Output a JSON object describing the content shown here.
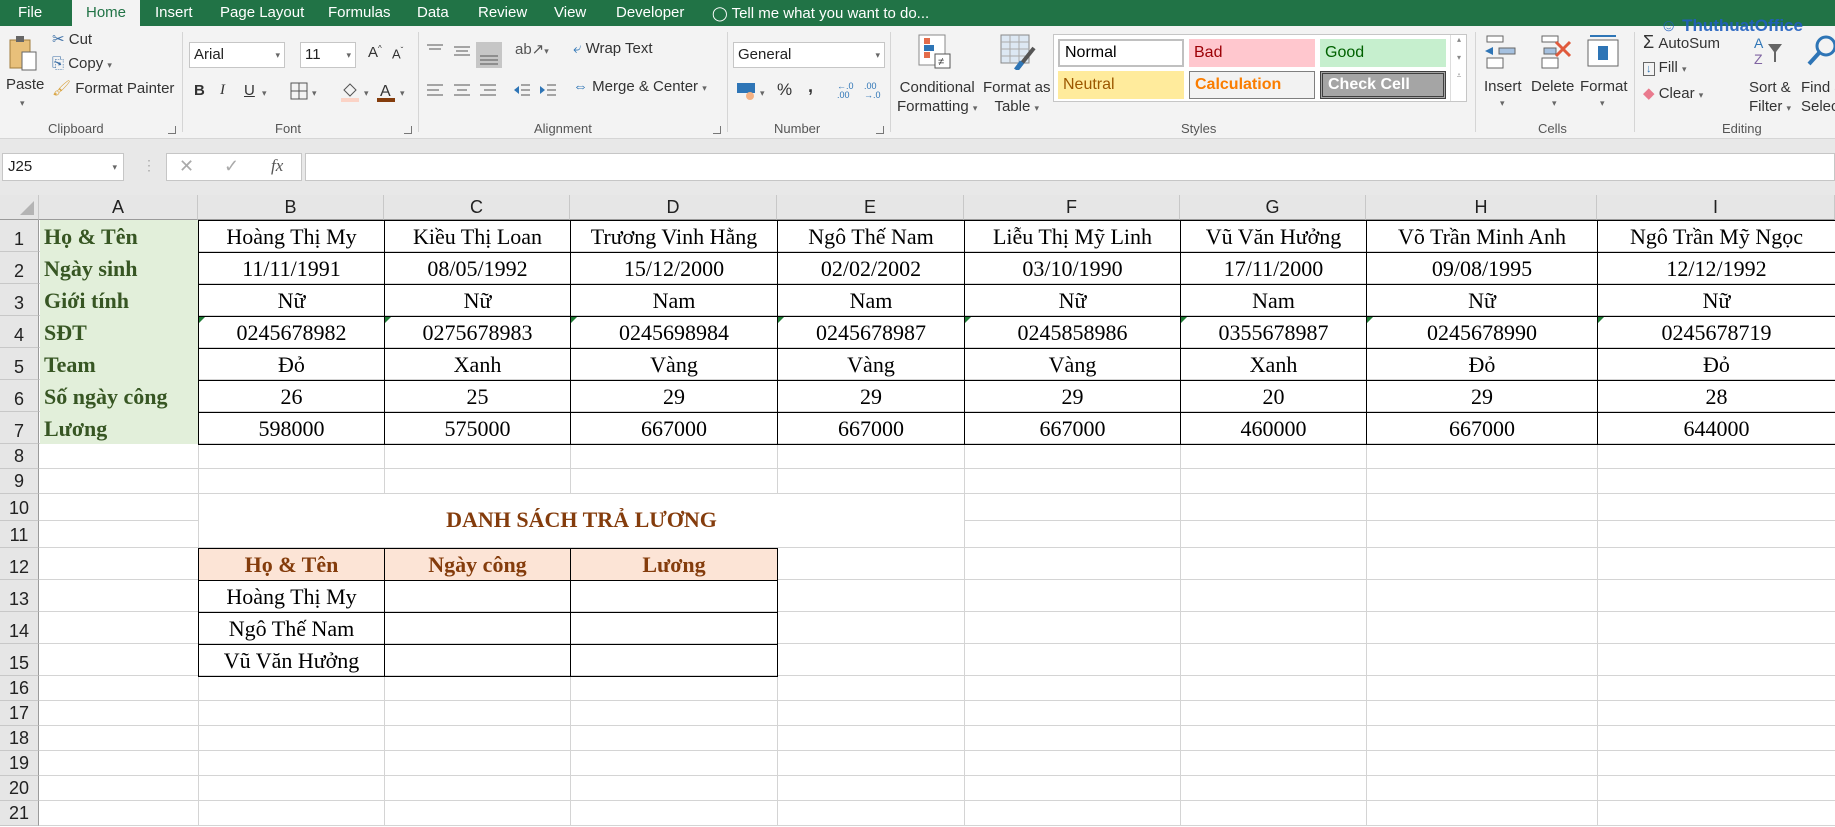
{
  "ribbon_tabs": [
    "File",
    "Home",
    "Insert",
    "Page Layout",
    "Formulas",
    "Data",
    "Review",
    "View",
    "Developer"
  ],
  "active_tab": "Home",
  "tell_me": "Tell me what you want to do...",
  "clipboard": {
    "paste": "Paste",
    "cut": "Cut",
    "copy": "Copy",
    "format_painter": "Format Painter",
    "label": "Clipboard"
  },
  "font": {
    "name": "Arial",
    "size": "11",
    "label": "Font",
    "bold": "B",
    "italic": "I",
    "underline": "U"
  },
  "alignment": {
    "wrap_text": "Wrap Text",
    "merge_center": "Merge & Center",
    "label": "Alignment"
  },
  "number": {
    "format": "General",
    "label": "Number",
    "percent": "%",
    "comma": ","
  },
  "styles": {
    "conditional_formatting": [
      "Conditional",
      "Formatting"
    ],
    "format_as_table": [
      "Format as",
      "Table"
    ],
    "cells": [
      {
        "name": "Normal",
        "fg": "#000000",
        "bg": "#ffffff"
      },
      {
        "name": "Bad",
        "fg": "#9c0006",
        "bg": "#ffc7ce"
      },
      {
        "name": "Good",
        "fg": "#006100",
        "bg": "#c6efce"
      },
      {
        "name": "Neutral",
        "fg": "#9c5700",
        "bg": "#ffeb9c"
      },
      {
        "name": "Calculation",
        "fg": "#fa7d00",
        "bg": "#f2f2f2"
      },
      {
        "name": "Check Cell",
        "fg": "#ffffff",
        "bg": "#a5a5a5"
      }
    ],
    "label": "Styles"
  },
  "cells_group": {
    "insert": "Insert",
    "delete": "Delete",
    "format": "Format",
    "label": "Cells"
  },
  "editing": {
    "autosum": "AutoSum",
    "fill": "Fill",
    "clear": "Clear",
    "sort_filter": [
      "Sort &",
      "Filter"
    ],
    "find_select": [
      "Find &",
      "Select"
    ],
    "label": "Editing"
  },
  "watermark": "ThuthuatOffice",
  "formula_bar": {
    "name_box": "J25",
    "formula": "",
    "fx": "fx"
  },
  "columns": [
    "A",
    "B",
    "C",
    "D",
    "E",
    "F",
    "G",
    "H",
    "I"
  ],
  "rows": [
    "1",
    "2",
    "3",
    "4",
    "5",
    "6",
    "7",
    "8",
    "9",
    "10",
    "11",
    "12",
    "13",
    "14",
    "15",
    "16",
    "17",
    "18",
    "19",
    "20",
    "21"
  ],
  "employee_table": {
    "row_labels": [
      "Họ & Tên",
      "Ngày sinh",
      "Giới tính",
      "SĐT",
      "Team",
      "Số ngày công",
      "Lương"
    ],
    "records": [
      [
        "Hoàng Thị My",
        "11/11/1991",
        "Nữ",
        "0245678982",
        "Đỏ",
        "26",
        "598000"
      ],
      [
        "Kiều Thị Loan",
        "08/05/1992",
        "Nữ",
        "0275678983",
        "Xanh",
        "25",
        "575000"
      ],
      [
        "Trương Vinh Hằng",
        "15/12/2000",
        "Nam",
        "0245698984",
        "Vàng",
        "29",
        "667000"
      ],
      [
        "Ngô Thế Nam",
        "02/02/2002",
        "Nam",
        "0245678987",
        "Vàng",
        "29",
        "667000"
      ],
      [
        "Liễu Thị Mỹ Linh",
        "03/10/1990",
        "Nữ",
        "0245858986",
        "Vàng",
        "29",
        "667000"
      ],
      [
        "Vũ Văn Hưởng",
        "17/11/2000",
        "Nam",
        "0355678987",
        "Xanh",
        "20",
        "460000"
      ],
      [
        "Võ Trần Minh Anh",
        "09/08/1995",
        "Nữ",
        "0245678990",
        "Đỏ",
        "29",
        "667000"
      ],
      [
        "Ngô Trần Mỹ Ngọc",
        "12/12/1992",
        "Nữ",
        "0245678719",
        "Đỏ",
        "28",
        "644000"
      ]
    ]
  },
  "payroll": {
    "title": "DANH SÁCH TRẢ LƯƠNG",
    "headers": [
      "Họ & Tên",
      "Ngày công",
      "Lương"
    ],
    "rows": [
      [
        "Hoàng Thị My",
        "",
        ""
      ],
      [
        "Ngô Thế Nam",
        "",
        ""
      ],
      [
        "Vũ Văn Hưởng",
        "",
        ""
      ]
    ]
  }
}
